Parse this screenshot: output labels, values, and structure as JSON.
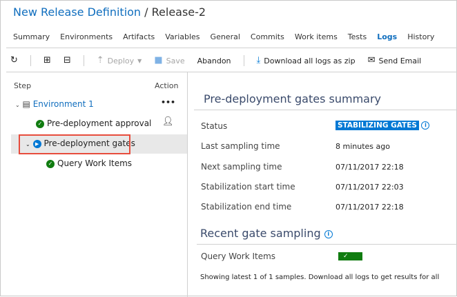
{
  "header": {
    "definition": "New Release Definition",
    "separator": " / ",
    "release": "Release-2"
  },
  "tabs": [
    "Summary",
    "Environments",
    "Artifacts",
    "Variables",
    "General",
    "Commits",
    "Work items",
    "Tests",
    "Logs",
    "History"
  ],
  "active_tab": "Logs",
  "toolbar": {
    "deploy": "Deploy",
    "save": "Save",
    "abandon": "Abandon",
    "download": "Download all logs as zip",
    "email": "Send Email"
  },
  "steps": {
    "col_step": "Step",
    "col_action": "Action",
    "environment": "Environment 1",
    "more": "•••",
    "approval": "Pre-deployment approval",
    "gates": "Pre-deployment gates",
    "query": "Query Work Items"
  },
  "summary": {
    "title": "Pre-deployment gates summary",
    "rows": [
      {
        "label": "Status",
        "value": "STABILIZING GATES"
      },
      {
        "label": "Last sampling time",
        "value": "8 minutes ago"
      },
      {
        "label": "Next sampling time",
        "value": "07/11/2017 22:18"
      },
      {
        "label": "Stabilization start time",
        "value": "07/11/2017 22:03"
      },
      {
        "label": "Stabilization end time",
        "value": "07/11/2017 22:18"
      }
    ]
  },
  "sampling": {
    "title": "Recent gate sampling",
    "gate": "Query Work  Items",
    "note": "Showing latest 1 of 1 samples. Download all logs to get results for all"
  },
  "colors": {
    "accent": "#0078d4",
    "success": "#107c10",
    "highlight": "#e74c3c"
  }
}
